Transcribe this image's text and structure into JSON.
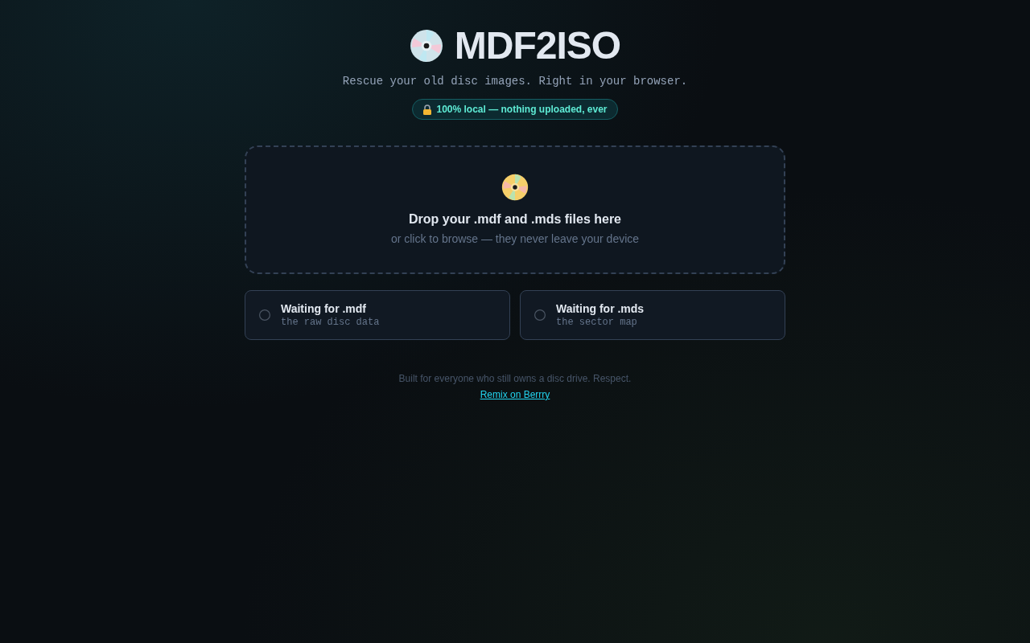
{
  "header": {
    "title": "MDF2ISO",
    "tagline": "Rescue your old disc images. Right in your browser.",
    "badge": "100% local — nothing uploaded, ever"
  },
  "dropzone": {
    "heading": "Drop your .mdf and .mds files here",
    "hint": "or click to browse — they never leave your device"
  },
  "files": [
    {
      "title": "Waiting for .mdf",
      "description": "the raw disc data",
      "loaded": false
    },
    {
      "title": "Waiting for .mds",
      "description": "the sector map",
      "loaded": false
    }
  ],
  "footer": {
    "note": "Built for everyone who still owns a disc drive. Respect.",
    "link": "Remix on Berrry"
  }
}
